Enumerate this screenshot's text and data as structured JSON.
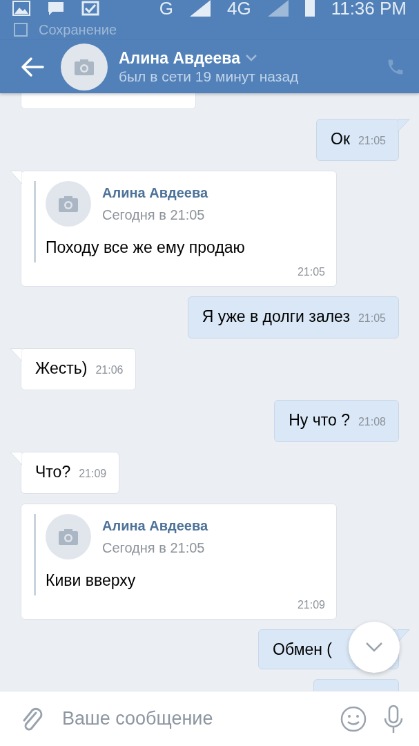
{
  "status_bar": {
    "network": "G",
    "network_2": "4G",
    "time": "11:36 PM",
    "notification": "Сохранение"
  },
  "header": {
    "name": "Алина Авдеева",
    "presence": "был в сети 19 минут назад"
  },
  "messages": [
    {
      "kind": "blank",
      "outgoing": false
    },
    {
      "kind": "text",
      "outgoing": true,
      "tail": true,
      "text": "Ок",
      "time": "21:05"
    },
    {
      "kind": "forward",
      "outgoing": false,
      "tail": true,
      "author": "Алина Авдеева",
      "date": "Сегодня в 21:05",
      "text": "Походу все же ему продаю",
      "time": "21:05"
    },
    {
      "kind": "text",
      "outgoing": true,
      "tail": false,
      "text": "Я уже в долги залез",
      "time": "21:05"
    },
    {
      "kind": "text",
      "outgoing": false,
      "tail": true,
      "text": "Жесть)",
      "time": "21:06"
    },
    {
      "kind": "text",
      "outgoing": true,
      "tail": false,
      "text": "Ну что ?",
      "time": "21:08"
    },
    {
      "kind": "text",
      "outgoing": false,
      "tail": true,
      "text": "Что?",
      "time": "21:09"
    },
    {
      "kind": "forward",
      "outgoing": false,
      "tail": false,
      "author": "Алина Авдеева",
      "date": "Сегодня в 21:05",
      "text": "Киви вверху",
      "time": "21:09"
    },
    {
      "kind": "text",
      "outgoing": true,
      "tail": true,
      "text": "Обмен ("
    },
    {
      "kind": "blank",
      "outgoing": true
    }
  ],
  "composer": {
    "placeholder": "Ваше сообщение"
  }
}
